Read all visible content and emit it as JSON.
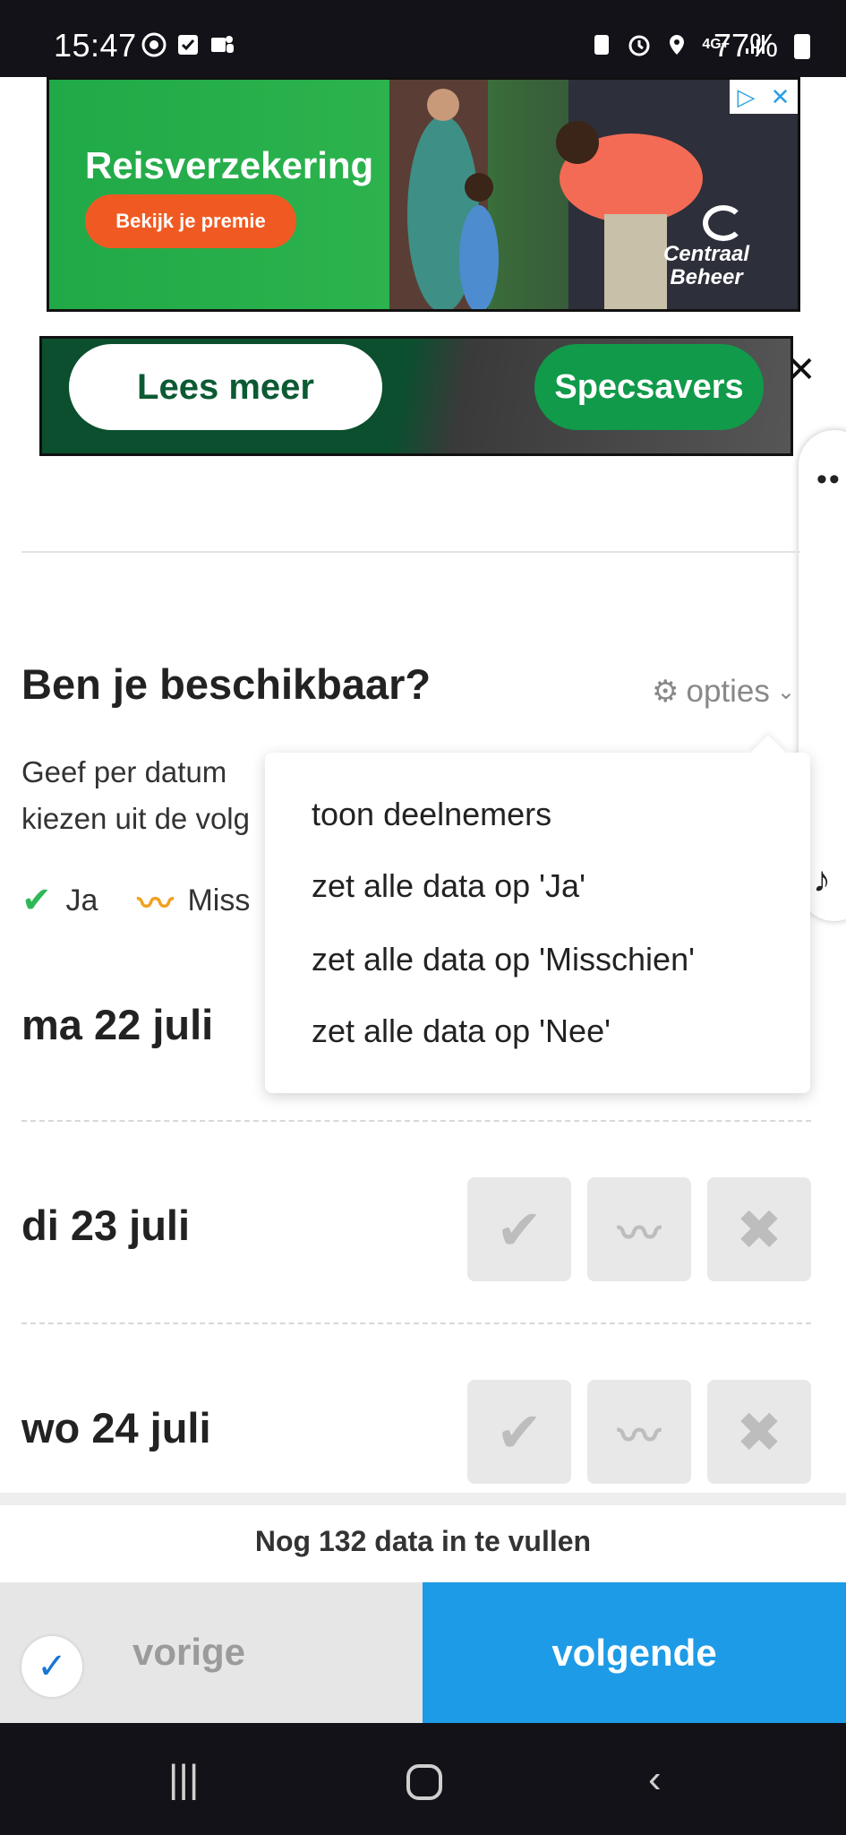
{
  "status_bar": {
    "time": "15:47",
    "network": "4G+",
    "battery": "77%"
  },
  "ads": {
    "ad1": {
      "headline": "Reisverzekering",
      "cta": "Bekijk je premie",
      "brand": "Centraal Beheer"
    },
    "ad2": {
      "cta": "Lees meer",
      "brand": "Specsavers"
    }
  },
  "availability": {
    "title": "Ben je beschikbaar?",
    "options_label": "opties",
    "description": "Geef per datum aan of je beschikbaar bent. Je kunt kiezen uit de volgende opties:",
    "description_visible_1": "Geef per datum",
    "description_visible_2": "kiezen uit de volg",
    "legend": {
      "yes": "Ja",
      "maybe": "Miss"
    },
    "dates": [
      {
        "label": "ma 22 juli"
      },
      {
        "label": "di 23 juli"
      },
      {
        "label": "wo 24 juli"
      }
    ]
  },
  "options_menu": {
    "items": [
      "toon deelnemers",
      "zet alle data op 'Ja'",
      "zet alle data op 'Misschien'",
      "zet alle data op 'Nee'"
    ]
  },
  "footer": {
    "remaining": "Nog 132 data in te vullen",
    "prev": "vorige",
    "next": "volgende"
  },
  "icons": {
    "yes": "check-icon",
    "maybe": "tilde-icon",
    "no": "x-icon",
    "options": "gear-icon"
  },
  "colors": {
    "yes": "#2fb857",
    "maybe": "#f2a01f",
    "next_button": "#1e9be6",
    "ad1_bg": "#21a948",
    "ad1_cta": "#f05a22",
    "ad2_bg": "#0b4f2e"
  }
}
